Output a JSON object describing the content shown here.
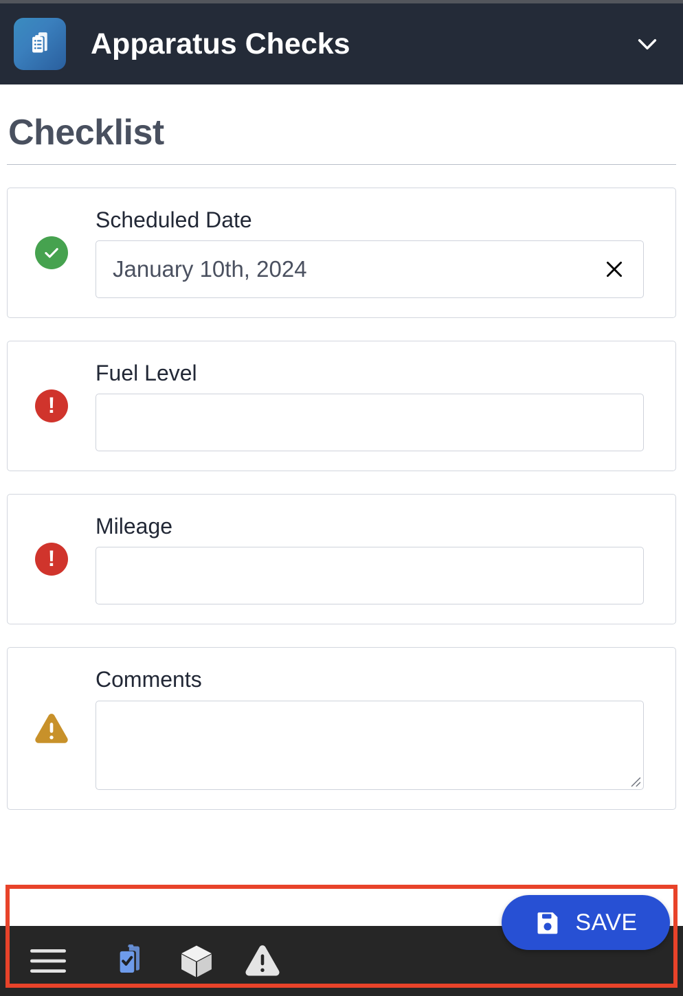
{
  "header": {
    "title": "Apparatus Checks",
    "app_icon": "clipboard-documents-icon",
    "expand_icon": "chevron-down-icon",
    "background_color": "#242b38",
    "icon_gradient_from": "#3a8cc0",
    "icon_gradient_to": "#2a5f9e"
  },
  "page": {
    "title": "Checklist"
  },
  "checklist": {
    "items": [
      {
        "status": "complete",
        "status_icon": "check-circle-icon",
        "status_color": "#46a24f",
        "label": "Scheduled Date",
        "value": "January 10th, 2024",
        "placeholder": "",
        "field_type": "text",
        "clear_icon": "close-x-icon",
        "has_clear": true
      },
      {
        "status": "required",
        "status_icon": "error-circle-icon",
        "status_color": "#d0342c",
        "label": "Fuel Level",
        "value": "",
        "placeholder": "",
        "field_type": "text",
        "clear_icon": "",
        "has_clear": false
      },
      {
        "status": "required",
        "status_icon": "error-circle-icon",
        "status_color": "#d0342c",
        "label": "Mileage",
        "value": "",
        "placeholder": "",
        "field_type": "text",
        "clear_icon": "",
        "has_clear": false
      },
      {
        "status": "warning",
        "status_icon": "warning-triangle-icon",
        "status_color": "#c8912a",
        "label": "Comments",
        "value": "",
        "placeholder": "",
        "field_type": "textarea",
        "clear_icon": "",
        "has_clear": false
      }
    ]
  },
  "footer": {
    "save_label": "SAVE",
    "save_icon": "floppy-disk-save-icon",
    "save_color": "#2750d4",
    "highlight_color": "#e8432a",
    "nav_background": "#262626",
    "nav_items": [
      {
        "name": "menu",
        "icon": "hamburger-menu-icon",
        "active": false,
        "color": "#e4e4e4"
      },
      {
        "name": "checklists",
        "icon": "clipboard-check-icon",
        "active": true,
        "color": "#6e9bea"
      },
      {
        "name": "inventory",
        "icon": "box-cube-icon",
        "active": false,
        "color": "#e4e4e4"
      },
      {
        "name": "alerts",
        "icon": "warning-triangle-icon",
        "active": false,
        "color": "#e4e4e4"
      }
    ]
  }
}
